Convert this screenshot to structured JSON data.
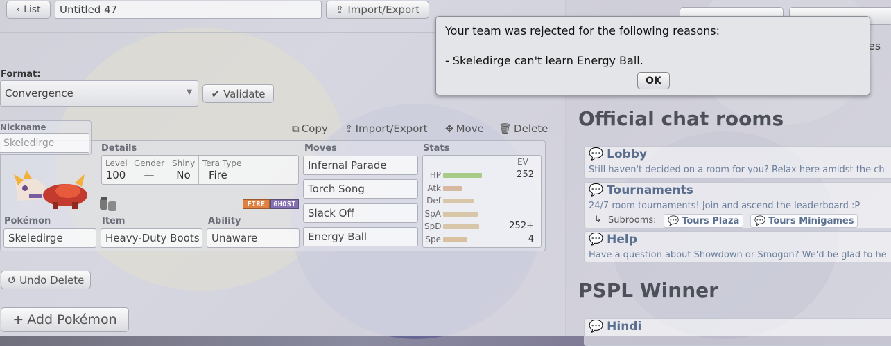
{
  "toolbar": {
    "list_label": "List",
    "team_name": "Untitled 47",
    "import_export_label": "Import/Export"
  },
  "format": {
    "label": "Format:",
    "value": "Convergence",
    "validate_label": "Validate"
  },
  "actions": {
    "copy": "Copy",
    "import_export": "Import/Export",
    "move": "Move",
    "delete": "Delete"
  },
  "set": {
    "nickname_label": "Nickname",
    "nickname_value": "Skeledirge",
    "details_label": "Details",
    "level_label": "Level",
    "level_value": "100",
    "gender_label": "Gender",
    "gender_value": "—",
    "shiny_label": "Shiny",
    "shiny_value": "No",
    "tera_label": "Tera Type",
    "tera_value": "Fire",
    "types": [
      {
        "name": "FIRE",
        "color": "#e08040"
      },
      {
        "name": "GHOST",
        "color": "#8470b0"
      }
    ],
    "pokemon_label": "Pokémon",
    "pokemon_value": "Skeledirge",
    "item_label": "Item",
    "item_value": "Heavy-Duty Boots",
    "ability_label": "Ability",
    "ability_value": "Unaware",
    "moves_label": "Moves",
    "moves": [
      "Infernal Parade",
      "Torch Song",
      "Slack Off",
      "Energy Ball"
    ],
    "stats_label": "Stats",
    "ev_header": "EV",
    "stats": [
      {
        "name": "HP",
        "ev": "252",
        "fill": 0.62,
        "color": "#a8cc88"
      },
      {
        "name": "Atk",
        "ev": "–",
        "fill": 0.3,
        "color": "#d8b8a0"
      },
      {
        "name": "Def",
        "ev": "",
        "fill": 0.5,
        "color": "#d8c6a8"
      },
      {
        "name": "SpA",
        "ev": "",
        "fill": 0.55,
        "color": "#d8c6a8"
      },
      {
        "name": "SpD",
        "ev": "252+",
        "fill": 0.58,
        "color": "#d8c6a8"
      },
      {
        "name": "Spe",
        "ev": "4",
        "fill": 0.38,
        "color": "#d8c0a0"
      }
    ]
  },
  "undo_label": "Undo Delete",
  "add_label": "Add Pokémon",
  "rooms": {
    "official_title": "Official chat rooms",
    "lobby_name": "Lobby",
    "lobby_desc": "Still haven't decided on a room for you? Relax here amidst the ch",
    "tournaments_name": "Tournaments",
    "tournaments_desc": "24/7 room tournaments! Join and ascend the leaderboard :P",
    "subrooms_label": "Subrooms:",
    "subroom_1": "Tours Plaza",
    "subroom_2": "Tours Minigames",
    "help_name": "Help",
    "help_desc": "Have a question about Showdown or Smogon? We'd be glad to he",
    "pspl_title": "PSPL Winner",
    "hindi_name": "Hindi",
    "partial_text": "es"
  },
  "popup": {
    "line1": "Your team was rejected for the following reasons:",
    "line2": "- Skeledirge can't learn Energy Ball.",
    "ok_label": "OK"
  }
}
